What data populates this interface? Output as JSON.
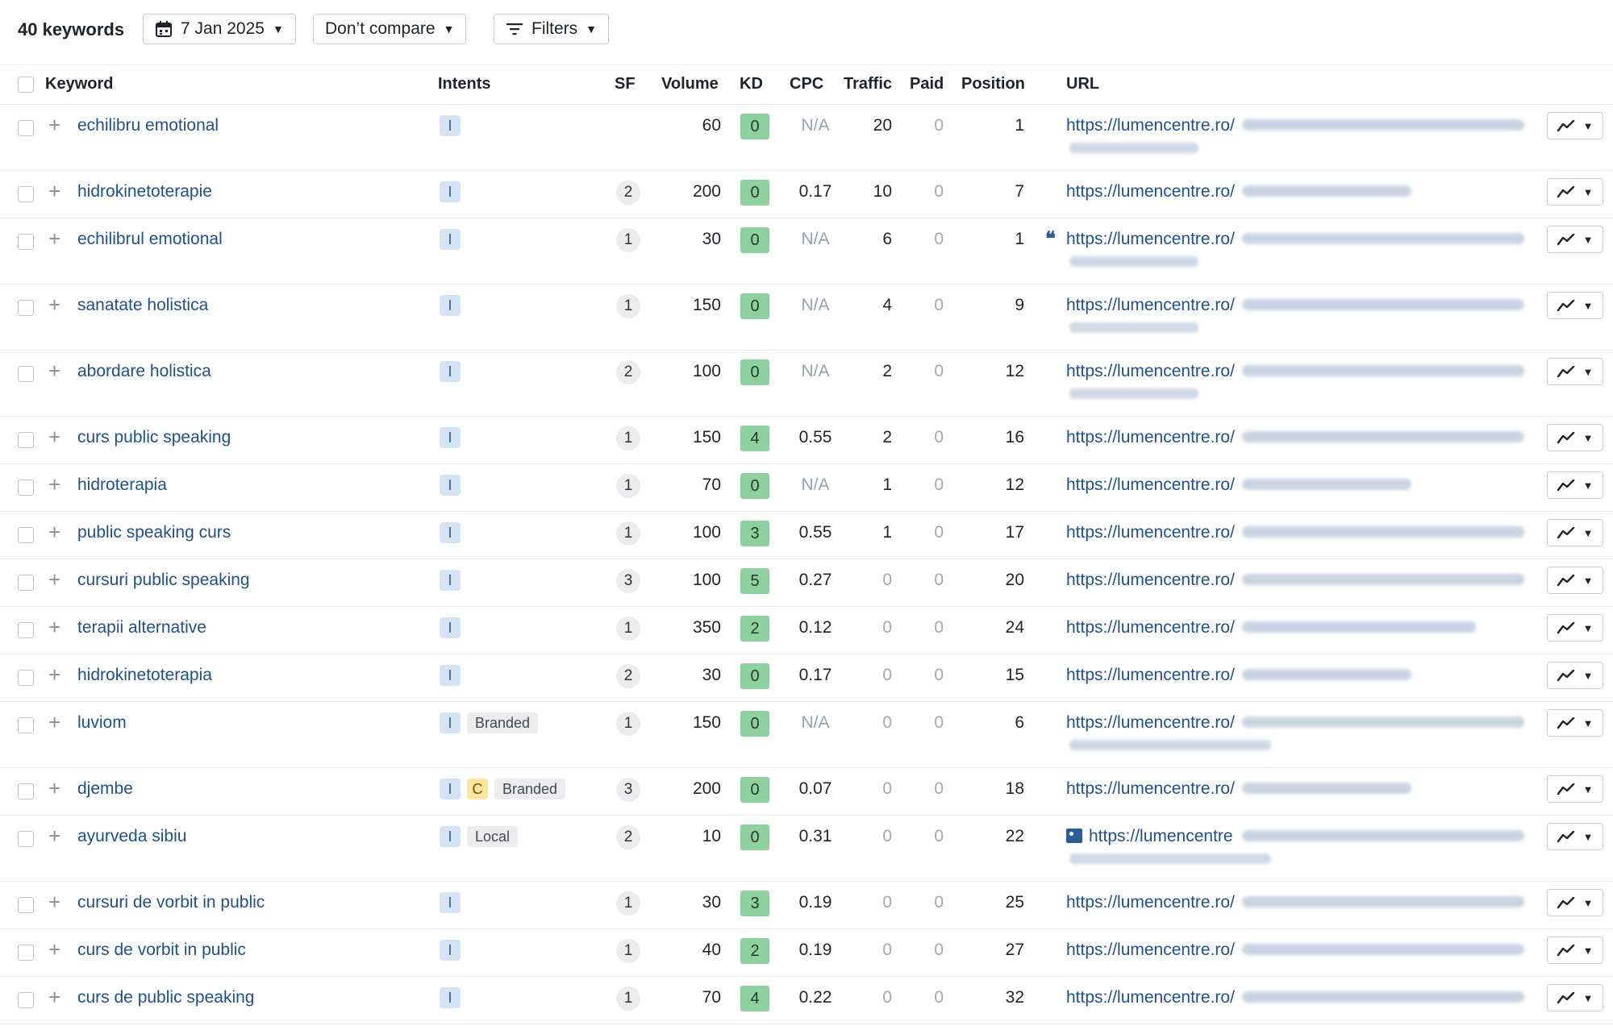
{
  "toolbar": {
    "keywords_count": "40 keywords",
    "date_label": "7 Jan 2025",
    "compare_label": "Don’t compare",
    "filters_label": "Filters"
  },
  "columns": {
    "keyword": "Keyword",
    "intents": "Intents",
    "sf": "SF",
    "volume": "Volume",
    "kd": "KD",
    "cpc": "CPC",
    "traffic": "Traffic",
    "paid": "Paid",
    "position": "Position",
    "url": "URL"
  },
  "colors": {
    "link": "#1f4f8f",
    "kd_green": "#8fd19e",
    "intent_informational": "#d5e4f5",
    "intent_commercial": "#fbe5a0"
  },
  "rows": [
    {
      "keyword": "echilibru emotional",
      "intents": [
        "I"
      ],
      "tags": [],
      "sf": "",
      "volume": "60",
      "kd": "0",
      "cpc": "N/A",
      "traffic": "20",
      "paid": "0",
      "position": "1",
      "url": "https://lumencentre.ro/",
      "url_icon": "",
      "tall": true
    },
    {
      "keyword": "hidrokinetoterapie",
      "intents": [
        "I"
      ],
      "tags": [],
      "sf": "2",
      "volume": "200",
      "kd": "0",
      "cpc": "0.17",
      "traffic": "10",
      "paid": "0",
      "position": "7",
      "url": "https://lumencentre.ro/",
      "url_icon": "",
      "tall": false
    },
    {
      "keyword": "echilibrul emotional",
      "intents": [
        "I"
      ],
      "tags": [],
      "sf": "1",
      "volume": "30",
      "kd": "0",
      "cpc": "N/A",
      "traffic": "6",
      "paid": "0",
      "position": "1",
      "url": "https://lumencentre.ro/",
      "url_icon": "quote-icon",
      "tall": true
    },
    {
      "keyword": "sanatate holistica",
      "intents": [
        "I"
      ],
      "tags": [],
      "sf": "1",
      "volume": "150",
      "kd": "0",
      "cpc": "N/A",
      "traffic": "4",
      "paid": "0",
      "position": "9",
      "url": "https://lumencentre.ro/",
      "url_icon": "",
      "tall": true
    },
    {
      "keyword": "abordare holistica",
      "intents": [
        "I"
      ],
      "tags": [],
      "sf": "2",
      "volume": "100",
      "kd": "0",
      "cpc": "N/A",
      "traffic": "2",
      "paid": "0",
      "position": "12",
      "url": "https://lumencentre.ro/",
      "url_icon": "",
      "tall": true
    },
    {
      "keyword": "curs public speaking",
      "intents": [
        "I"
      ],
      "tags": [],
      "sf": "1",
      "volume": "150",
      "kd": "4",
      "cpc": "0.55",
      "traffic": "2",
      "paid": "0",
      "position": "16",
      "url": "https://lumencentre.ro/",
      "url_icon": "",
      "tall": false
    },
    {
      "keyword": "hidroterapia",
      "intents": [
        "I"
      ],
      "tags": [],
      "sf": "1",
      "volume": "70",
      "kd": "0",
      "cpc": "N/A",
      "traffic": "1",
      "paid": "0",
      "position": "12",
      "url": "https://lumencentre.ro/",
      "url_icon": "",
      "tall": false
    },
    {
      "keyword": "public speaking curs",
      "intents": [
        "I"
      ],
      "tags": [],
      "sf": "1",
      "volume": "100",
      "kd": "3",
      "cpc": "0.55",
      "traffic": "1",
      "paid": "0",
      "position": "17",
      "url": "https://lumencentre.ro/",
      "url_icon": "",
      "tall": false
    },
    {
      "keyword": "cursuri public speaking",
      "intents": [
        "I"
      ],
      "tags": [],
      "sf": "3",
      "volume": "100",
      "kd": "5",
      "cpc": "0.27",
      "traffic": "0",
      "paid": "0",
      "position": "20",
      "url": "https://lumencentre.ro/",
      "url_icon": "",
      "tall": false
    },
    {
      "keyword": "terapii alternative",
      "intents": [
        "I"
      ],
      "tags": [],
      "sf": "1",
      "volume": "350",
      "kd": "2",
      "cpc": "0.12",
      "traffic": "0",
      "paid": "0",
      "position": "24",
      "url": "https://lumencentre.ro/",
      "url_icon": "",
      "tall": false
    },
    {
      "keyword": "hidrokinetoterapia",
      "intents": [
        "I"
      ],
      "tags": [],
      "sf": "2",
      "volume": "30",
      "kd": "0",
      "cpc": "0.17",
      "traffic": "0",
      "paid": "0",
      "position": "15",
      "url": "https://lumencentre.ro/",
      "url_icon": "",
      "tall": false
    },
    {
      "keyword": "luviom",
      "intents": [
        "I"
      ],
      "tags": [
        "Branded"
      ],
      "sf": "1",
      "volume": "150",
      "kd": "0",
      "cpc": "N/A",
      "traffic": "0",
      "paid": "0",
      "position": "6",
      "url": "https://lumencentre.ro/",
      "url_icon": "",
      "tall": true
    },
    {
      "keyword": "djembe",
      "intents": [
        "I",
        "C"
      ],
      "tags": [
        "Branded"
      ],
      "sf": "3",
      "volume": "200",
      "kd": "0",
      "cpc": "0.07",
      "traffic": "0",
      "paid": "0",
      "position": "18",
      "url": "https://lumencentre.ro/",
      "url_icon": "",
      "tall": false
    },
    {
      "keyword": "ayurveda sibiu",
      "intents": [
        "I"
      ],
      "tags": [
        "Local"
      ],
      "sf": "2",
      "volume": "10",
      "kd": "0",
      "cpc": "0.31",
      "traffic": "0",
      "paid": "0",
      "position": "22",
      "url": "https://lumencentre",
      "url_icon": "image-icon",
      "tall": true
    },
    {
      "keyword": "cursuri de vorbit in public",
      "intents": [
        "I"
      ],
      "tags": [],
      "sf": "1",
      "volume": "30",
      "kd": "3",
      "cpc": "0.19",
      "traffic": "0",
      "paid": "0",
      "position": "25",
      "url": "https://lumencentre.ro/",
      "url_icon": "",
      "tall": false
    },
    {
      "keyword": "curs de vorbit in public",
      "intents": [
        "I"
      ],
      "tags": [],
      "sf": "1",
      "volume": "40",
      "kd": "2",
      "cpc": "0.19",
      "traffic": "0",
      "paid": "0",
      "position": "27",
      "url": "https://lumencentre.ro/",
      "url_icon": "",
      "tall": false
    },
    {
      "keyword": "curs de public speaking",
      "intents": [
        "I"
      ],
      "tags": [],
      "sf": "1",
      "volume": "70",
      "kd": "4",
      "cpc": "0.22",
      "traffic": "0",
      "paid": "0",
      "position": "32",
      "url": "https://lumencentre.ro/",
      "url_icon": "",
      "tall": false
    }
  ]
}
